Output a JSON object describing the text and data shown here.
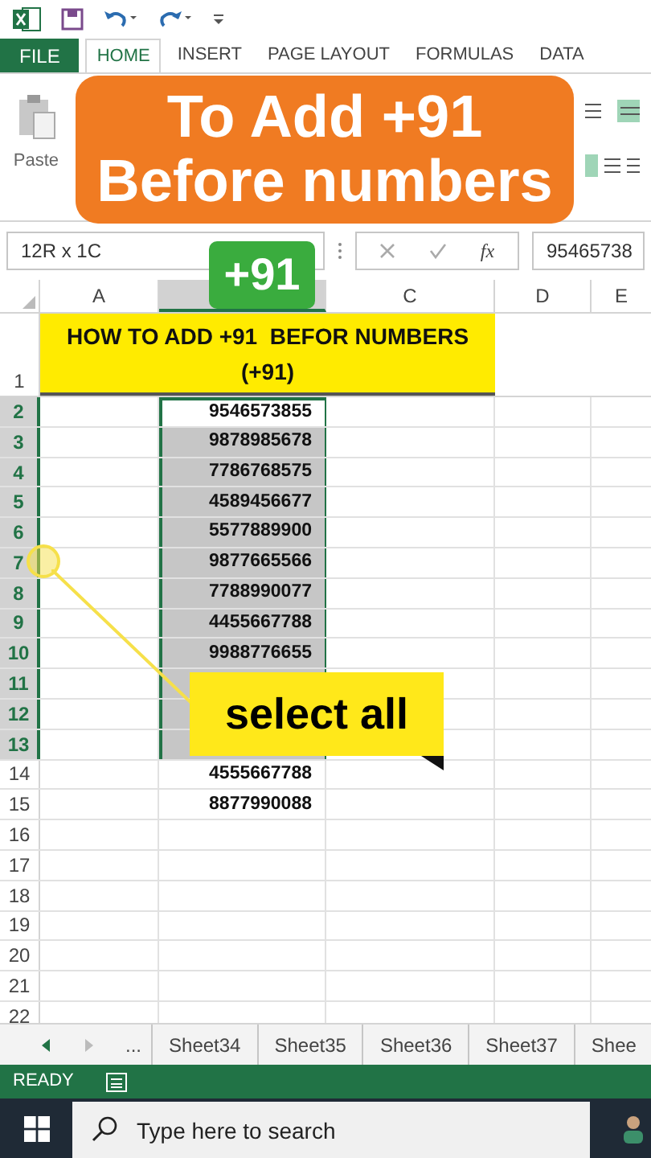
{
  "ribbon_tabs": [
    {
      "label": "FILE",
      "kind": "file",
      "selected": false
    },
    {
      "label": "HOME",
      "kind": "tab",
      "selected": true
    },
    {
      "label": "INSERT",
      "kind": "tab",
      "selected": false
    },
    {
      "label": "PAGE LAYOUT",
      "kind": "tab",
      "selected": false
    },
    {
      "label": "FORMULAS",
      "kind": "tab",
      "selected": false
    },
    {
      "label": "DATA",
      "kind": "tab",
      "selected": false
    }
  ],
  "ribbon": {
    "paste_label": "Paste"
  },
  "banner": {
    "lines": [
      "To Add +91",
      "Before numbers"
    ]
  },
  "formula_bar": {
    "name_box": "12R x 1C",
    "fx": "fx",
    "value": "95465738"
  },
  "badge": "+91",
  "columns": [
    {
      "label": "A",
      "selected": false
    },
    {
      "selected": true
    },
    {
      "label": "C",
      "selected": false
    },
    {
      "label": "D",
      "selected": false
    },
    {
      "label": "E",
      "selected": false
    }
  ],
  "title_row": {
    "header": "1",
    "text": "HOW TO ADD +91  BEFOR NUMBERS (+91)"
  },
  "rows": [
    {
      "header": "2",
      "value": "9546573855",
      "selected": true,
      "active": true
    },
    {
      "header": "3",
      "value": "9878985678",
      "selected": true,
      "active": false
    },
    {
      "header": "4",
      "value": "7786768575",
      "selected": true,
      "active": false
    },
    {
      "header": "5",
      "value": "4589456677",
      "selected": true,
      "active": false
    },
    {
      "header": "6",
      "value": "5577889900",
      "selected": true,
      "active": false
    },
    {
      "header": "7",
      "value": "9877665566",
      "selected": true,
      "active": false
    },
    {
      "header": "8",
      "value": "7788990077",
      "selected": true,
      "active": false
    },
    {
      "header": "9",
      "value": "4455667788",
      "selected": true,
      "active": false
    },
    {
      "header": "10",
      "value": "9988776655",
      "selected": true,
      "active": false
    },
    {
      "header": "11",
      "selected": true,
      "active": false
    },
    {
      "header": "12",
      "selected": true,
      "active": false
    },
    {
      "header": "13",
      "selected": true,
      "active": false
    },
    {
      "header": "14",
      "value": "4555667788",
      "selected": false,
      "active": false
    },
    {
      "header": "15",
      "value": "8877990088",
      "selected": false,
      "active": false
    },
    {
      "header": "16",
      "selected": false,
      "active": false
    },
    {
      "header": "17",
      "selected": false,
      "active": false
    },
    {
      "header": "18",
      "selected": false,
      "active": false
    },
    {
      "header": "19",
      "selected": false,
      "active": false
    },
    {
      "header": "20",
      "selected": false,
      "active": false
    },
    {
      "header": "21",
      "selected": false,
      "active": false
    },
    {
      "header": "22",
      "selected": false,
      "active": false
    }
  ],
  "callout": "select all",
  "sheet_tabs": {
    "more": "...",
    "tabs": [
      "Sheet34",
      "Sheet35",
      "Sheet36",
      "Sheet37",
      "Shee"
    ]
  },
  "status_bar": {
    "text": "READY"
  },
  "taskbar": {
    "search_placeholder": "Type here to search"
  }
}
